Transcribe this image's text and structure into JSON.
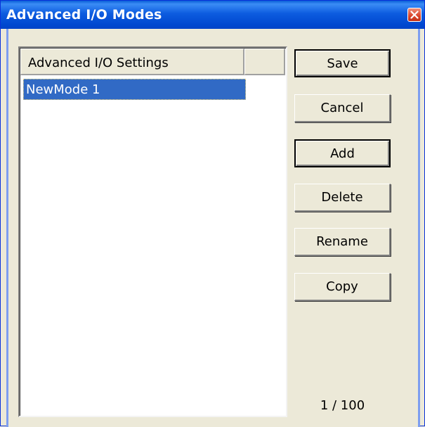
{
  "window": {
    "title": "Advanced I/O Modes",
    "close_icon": "close-icon"
  },
  "list": {
    "columns": [
      "Advanced I/O Settings",
      ""
    ],
    "items": [
      {
        "label": "NewMode 1",
        "selected": true
      }
    ]
  },
  "buttons": {
    "save": "Save",
    "cancel": "Cancel",
    "add": "Add",
    "delete": "Delete",
    "rename": "Rename",
    "copy": "Copy"
  },
  "status": {
    "count": "1 / 100"
  },
  "colors": {
    "titlebar": "#0054e3",
    "selection": "#316ac5",
    "face": "#ece9d8",
    "close": "#d9442a"
  }
}
